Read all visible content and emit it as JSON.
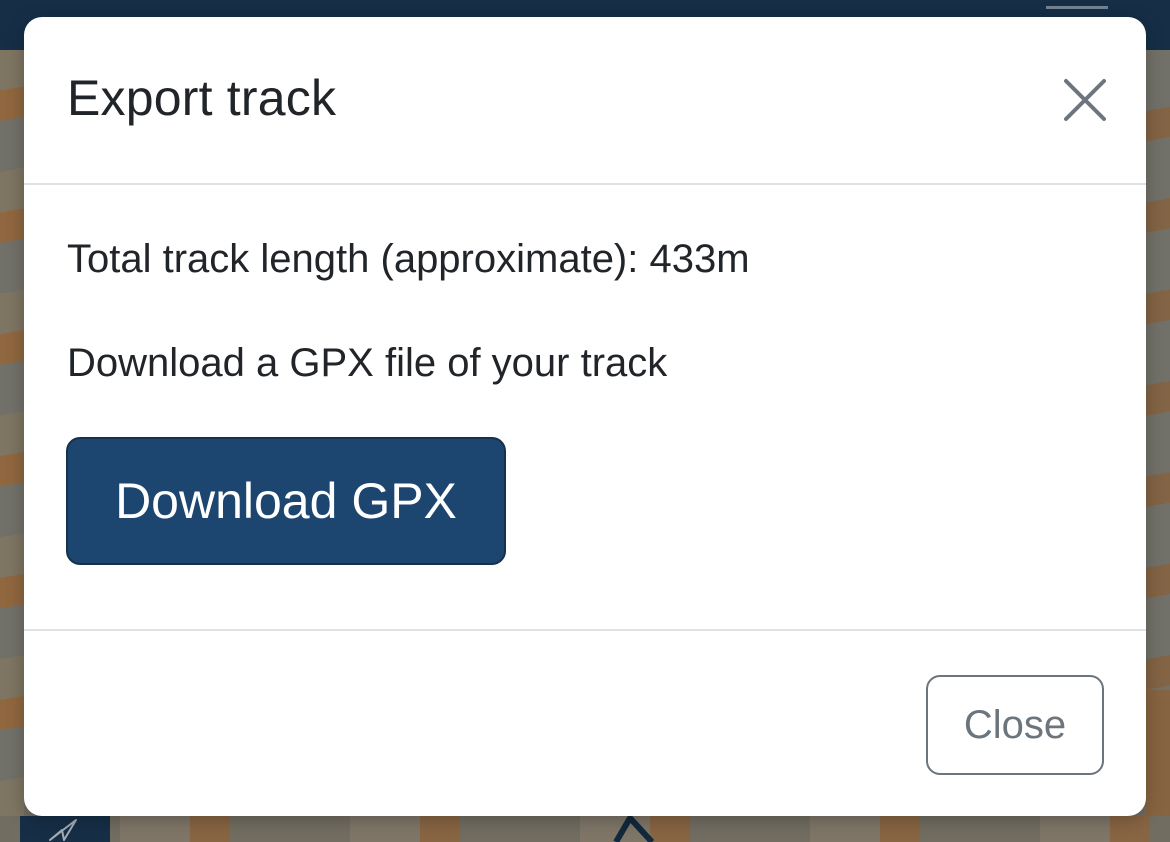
{
  "modal": {
    "title": "Export track",
    "close_icon": "close-icon",
    "body": {
      "track_length_text": "Total track length (approximate): 433m",
      "download_text": "Download a GPX file of your track",
      "download_button_label": "Download GPX"
    },
    "footer": {
      "close_button_label": "Close"
    }
  },
  "background": {
    "locate_icon": "navigation-arrow-icon",
    "menu_icon": "menu-icon"
  },
  "colors": {
    "primary": "#1c4670",
    "topbar": "#1b3a57",
    "secondary": "#6c757d",
    "text": "#212529"
  }
}
